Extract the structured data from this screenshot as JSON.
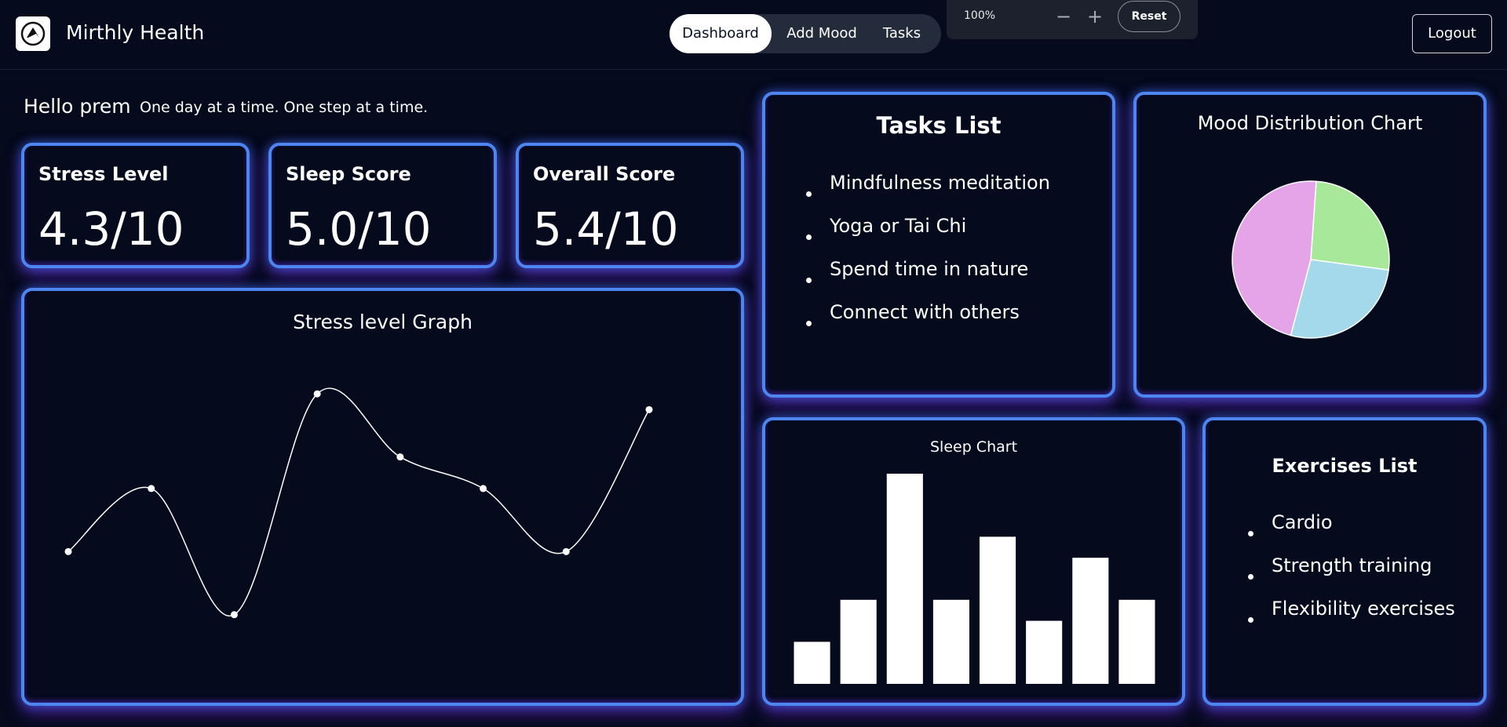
{
  "header": {
    "app_title": "Mirthly Health",
    "logo_icon": "triangle-logo-icon",
    "nav_tabs": [
      {
        "label": "Dashboard",
        "active": true
      },
      {
        "label": "Add Mood",
        "active": false
      },
      {
        "label": "Tasks",
        "active": false
      }
    ],
    "logout_label": "Logout"
  },
  "zoom": {
    "level": "100%",
    "minus": "−",
    "plus": "+",
    "reset_label": "Reset"
  },
  "greeting": {
    "hello": "Hello prem",
    "tagline": "One day at a time. One step at a time."
  },
  "scores": [
    {
      "title": "Stress Level",
      "value": "4.3/10"
    },
    {
      "title": "Sleep Score",
      "value": "5.0/10"
    },
    {
      "title": "Overall Score",
      "value": "5.4/10"
    }
  ],
  "tasks": {
    "title": "Tasks List",
    "items": [
      "Mindfulness meditation",
      "Yoga or Tai Chi",
      "Spend time in nature",
      "Connect with others"
    ]
  },
  "exercises": {
    "title": "Exercises List",
    "items": [
      "Cardio",
      "Strength training",
      "Flexibility exercises"
    ]
  },
  "colors": {
    "background": "#050a1c",
    "card_border": "#4d86f0",
    "glow_purple": "#7828e6",
    "pie_green": "#a8e89a",
    "pie_blue": "#a3d9ea",
    "pie_pink": "#e5a3e8"
  },
  "chart_data": [
    {
      "type": "line",
      "title": "Stress level Graph",
      "grid": false,
      "x": [
        1,
        2,
        3,
        4,
        5,
        6,
        7,
        8
      ],
      "values": [
        3,
        5,
        1,
        8,
        6,
        5,
        3,
        7.5
      ],
      "ylim": [
        0,
        9
      ]
    },
    {
      "type": "pie",
      "title": "Mood Distribution Chart",
      "values": [
        26,
        27,
        47
      ],
      "colors": [
        "#a8e89a",
        "#a3d9ea",
        "#e5a3e8"
      ]
    },
    {
      "type": "bar",
      "title": "Sleep Chart",
      "values": [
        2,
        4,
        10,
        4,
        7,
        3,
        6,
        4
      ],
      "ylim": [
        0,
        10
      ]
    }
  ]
}
